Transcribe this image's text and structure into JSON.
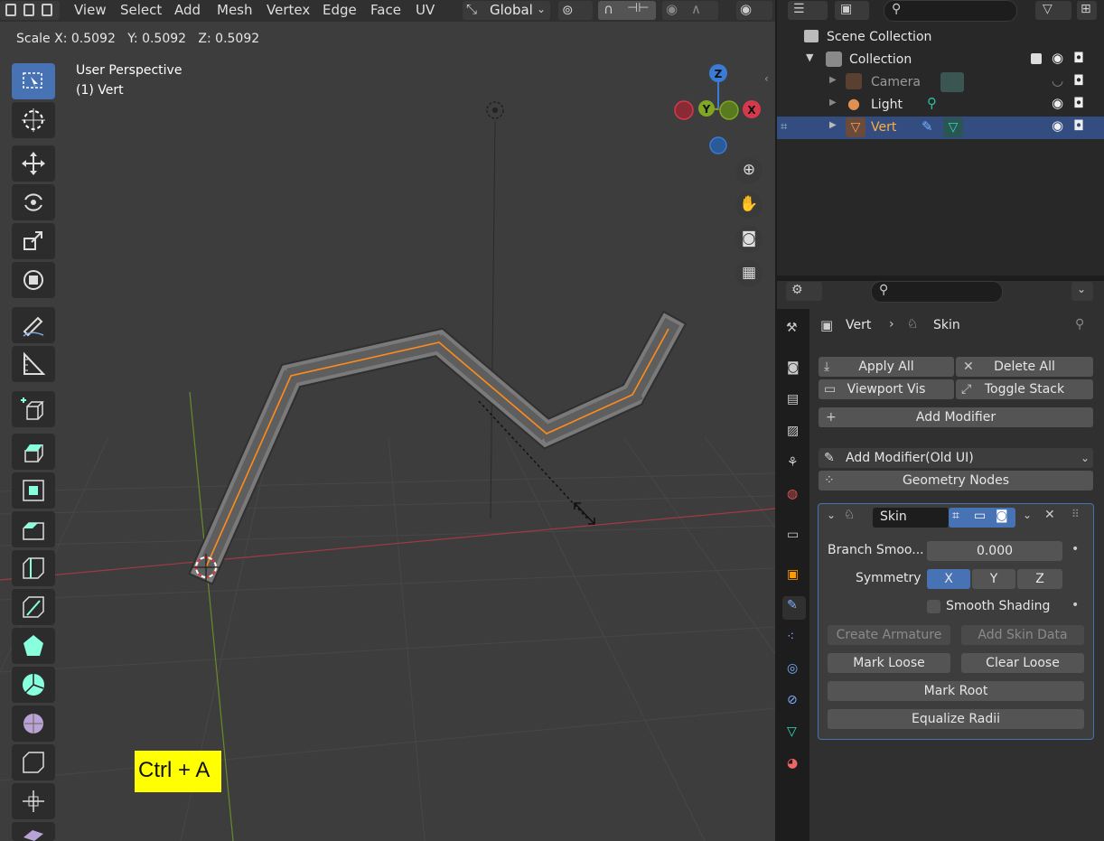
{
  "header": {
    "menus": [
      "View",
      "Select",
      "Add",
      "Mesh",
      "Vertex",
      "Edge",
      "Face",
      "UV"
    ],
    "orientation": "Global"
  },
  "operator_status": "Scale X: 0.5092   Y: 0.5092   Z: 0.5092",
  "viewport": {
    "perspective_label": "User Perspective",
    "object_label": "(1) Vert",
    "gizmo_axes": {
      "z": "Z",
      "y": "Y",
      "x": "X"
    }
  },
  "outliner": {
    "items": [
      {
        "label": "Scene Collection",
        "icon": "scene-collection-icon"
      },
      {
        "label": "Collection",
        "icon": "collection-icon"
      },
      {
        "label": "Camera",
        "icon": "camera-icon"
      },
      {
        "label": "Light",
        "icon": "light-icon"
      },
      {
        "label": "Vert",
        "icon": "mesh-icon"
      }
    ]
  },
  "properties": {
    "breadcrumb_object": "Vert",
    "breadcrumb_modifier": "Skin",
    "apply_all": "Apply All",
    "delete_all": "Delete All",
    "viewport_vis": "Viewport Vis",
    "toggle_stack": "Toggle Stack",
    "add_modifier": "Add Modifier",
    "add_modifier_old": "Add Modifier(Old UI)",
    "geometry_nodes": "Geometry Nodes",
    "modifier": {
      "name": "Skin",
      "branch_label": "Branch Smoo...",
      "branch_value": "0.000",
      "symmetry_label": "Symmetry",
      "sym_x": "X",
      "sym_y": "Y",
      "sym_z": "Z",
      "smooth_shading": "Smooth Shading",
      "create_armature": "Create Armature",
      "add_skin_data": "Add Skin Data",
      "mark_loose": "Mark Loose",
      "clear_loose": "Clear Loose",
      "mark_root": "Mark Root",
      "equalize_radii": "Equalize Radii"
    }
  },
  "key_hint": "Ctrl + A",
  "colors": {
    "accent": "#4772b3",
    "selection": "#334d80",
    "edge_orange": "#ff8c1a",
    "x_axis": "#d43a4c",
    "y_axis": "#7fa722",
    "z_axis": "#3a7bd5",
    "hint_bg": "#ffff00"
  }
}
